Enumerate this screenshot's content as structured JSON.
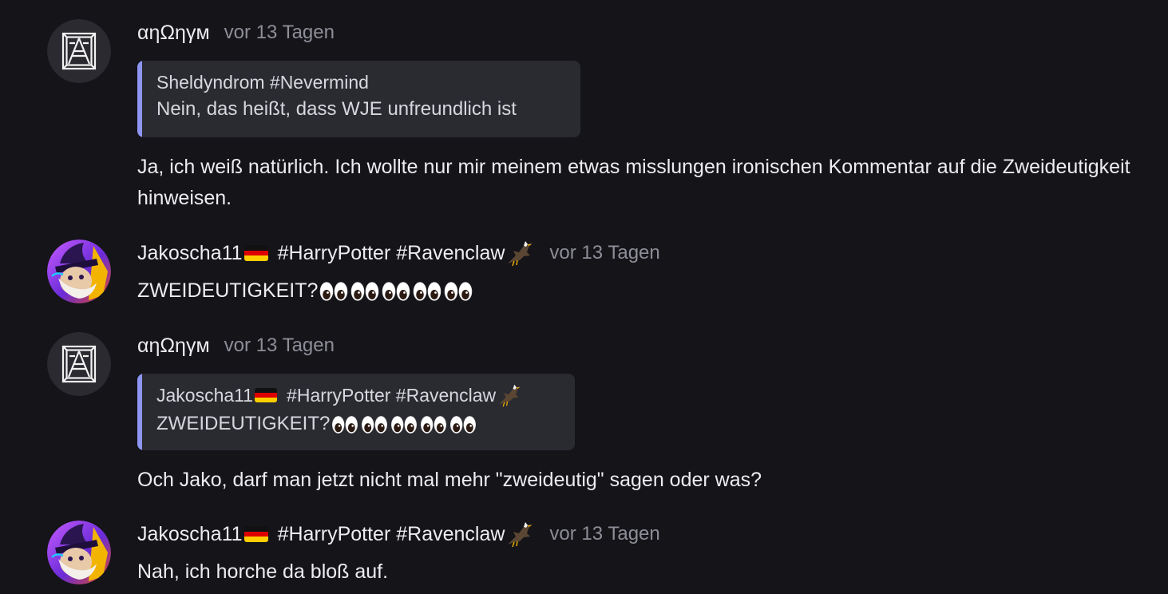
{
  "messages": [
    {
      "author": "αηΩηγм",
      "time": "vor 13 Tagen",
      "quote": {
        "author": "Sheldyndrom #Nevermind",
        "text": "Nein, das heißt, dass WJE unfreundlich ist"
      },
      "text": "Ja, ich weiß natürlich. Ich wollte nur mir meinem etwas misslungen ironischen Kommentar auf die Zweideutigkeit hinweisen."
    },
    {
      "author": "Jakoscha11",
      "hashtags": "#HarryPotter #Ravenclaw",
      "time": "vor 13 Tagen",
      "text": "ZWEIDEUTIGKEIT?"
    },
    {
      "author": "αηΩηγм",
      "time": "vor 13 Tagen",
      "quote": {
        "author": "Jakoscha11",
        "hashtags": "#HarryPotter #Ravenclaw",
        "text": "ZWEIDEUTIGKEIT?"
      },
      "text": "Och Jako, darf man jetzt nicht mal mehr \"zweideutig\" sagen oder was?"
    },
    {
      "author": "Jakoscha11",
      "hashtags": "#HarryPotter #Ravenclaw",
      "time": "vor 13 Tagen",
      "text": "Nah, ich horche da bloß auf."
    }
  ],
  "icons": {
    "flag": "german-flag-icon",
    "bird": "eagle-icon",
    "eyes": "eyes-emoji-icon"
  },
  "colors": {
    "background": "#141419",
    "quote_background": "#2a2a31",
    "quote_accent": "#8e95f2",
    "timestamp": "#8e8e98"
  }
}
